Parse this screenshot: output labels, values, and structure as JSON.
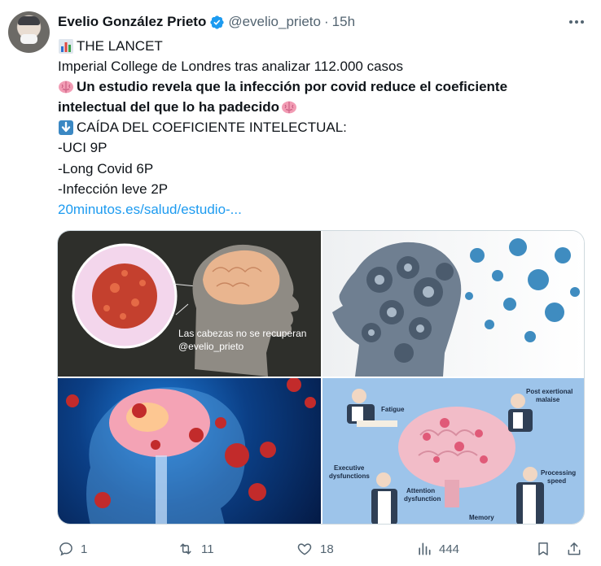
{
  "tweet": {
    "author_name": "Evelio González Prieto",
    "handle": "@evelio_prieto",
    "separator": "·",
    "time": "15h",
    "lines": [
      {
        "emoji": "bar-chart-emoji",
        "text": "THE LANCET",
        "bold": false
      },
      {
        "emoji": null,
        "text": "Imperial College de Londres tras analizar 112.000 casos",
        "bold": false
      },
      {
        "emoji": "brain-emoji",
        "text": "Un estudio revela que la infección por covid reduce el coeficiente",
        "bold": true
      },
      {
        "emoji": null,
        "text": "intelectual del que lo ha padecido",
        "bold": true,
        "trailing_emoji": "brain-emoji"
      },
      {
        "emoji": "down-arrow-emoji",
        "text": "CAÍDA DEL COEFICIENTE INTELECTUAL:",
        "bold": false
      },
      {
        "emoji": null,
        "text": "-UCI 9P",
        "bold": false
      },
      {
        "emoji": null,
        "text": "-Long Covid 6P",
        "bold": false
      },
      {
        "emoji": null,
        "text": "-Infección leve 2P",
        "bold": false
      }
    ],
    "link_text": "20minutos.es/salud/estudio-..."
  },
  "media": {
    "image1_caption_line1": "Las cabezas no se recuperan",
    "image1_caption_line2": "@evelio_prieto",
    "image4_labels": {
      "fatigue": "Fatigue",
      "post_exertional": "Post exertional",
      "malaise": "malaise",
      "executive": "Executive",
      "dysfunctions": "dysfunctions",
      "attention": "Attention",
      "dysfunction": "dysfunction",
      "processing": "Processing",
      "speed": "speed",
      "memory": "Memory"
    }
  },
  "actions": {
    "replies": "1",
    "retweets": "11",
    "likes": "18",
    "views": "444"
  },
  "colors": {
    "accent": "#1d9bf0",
    "secondary_text": "#536471",
    "primary_text": "#0f1419",
    "border": "#cfd9de"
  },
  "icons": [
    "verified-badge-icon",
    "more-icon",
    "reply-icon",
    "retweet-icon",
    "like-icon",
    "views-icon",
    "bookmark-icon",
    "share-icon"
  ]
}
